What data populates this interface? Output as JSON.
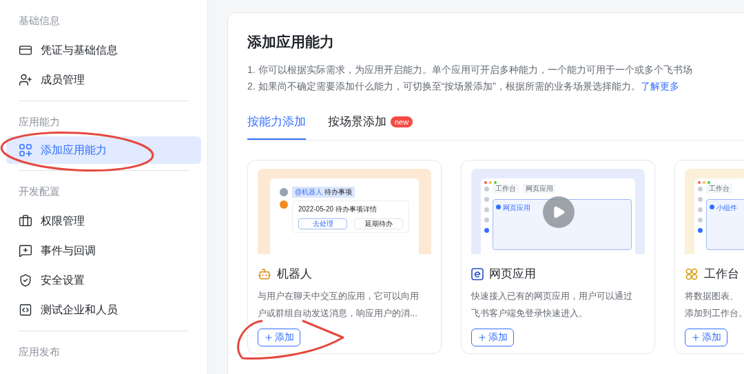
{
  "sidebar": {
    "sections": [
      {
        "title": "基础信息",
        "items": [
          {
            "label": "凭证与基础信息",
            "selected": false
          },
          {
            "label": "成员管理",
            "selected": false
          }
        ]
      },
      {
        "title": "应用能力",
        "items": [
          {
            "label": "添加应用能力",
            "selected": true
          }
        ]
      },
      {
        "title": "开发配置",
        "items": [
          {
            "label": "权限管理",
            "selected": false
          },
          {
            "label": "事件与回调",
            "selected": false
          },
          {
            "label": "安全设置",
            "selected": false
          },
          {
            "label": "测试企业和人员",
            "selected": false
          }
        ]
      },
      {
        "title": "应用发布"
      }
    ]
  },
  "page": {
    "title": "添加应用能力",
    "notes": [
      {
        "text": "1. 你可以根据实际需求，为应用开启能力。单个应用可开启多种能力，一个能力可用于一个或多个飞书场"
      },
      {
        "text": "2. 如果尚不确定需要添加什么能力，可切换至“按场景添加”，根据所需的业务场景选择能力。",
        "link": "了解更多"
      }
    ],
    "tabs": [
      {
        "label": "按能力添加",
        "selected": true
      },
      {
        "label": "按场景添加",
        "selected": false,
        "badge": "new"
      }
    ],
    "cards": [
      {
        "title": "机器人",
        "description_lines": [
          "与用户在聊天中交互的应用，它可以向用",
          "户或群组自动发送消息，响应用户的消..."
        ],
        "button": "添加",
        "preview": {
          "kind": "chat",
          "mention": "@机器人",
          "topic": "待办事项",
          "message": "2022-05-20 待办事项详情",
          "actions": [
            "去处理",
            "延期待办"
          ]
        }
      },
      {
        "title": "网页应用",
        "description_lines": [
          "快速接入已有的网页应用，用户可以通过",
          "飞书客户端免登录快速进入。"
        ],
        "button": "添加",
        "preview": {
          "kind": "web",
          "tabs": [
            "工作台",
            "网页应用"
          ],
          "label": "网页应用"
        }
      },
      {
        "title": "工作台",
        "description_lines": [
          "将数据图表、",
          "添加到工作台。"
        ],
        "button": "添加",
        "preview": {
          "kind": "widget",
          "tabs": [
            "工作台"
          ],
          "label": "小组件"
        }
      }
    ]
  },
  "annotations": [
    {
      "kind": "ellipse"
    },
    {
      "kind": "scribble"
    }
  ]
}
